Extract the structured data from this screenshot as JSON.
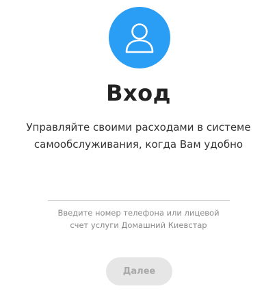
{
  "colors": {
    "accent": "#2a9df4",
    "title": "#222222",
    "hint": "#8a8a8a",
    "button_bg": "#e6e6e6",
    "button_text": "#a9a9a9"
  },
  "avatar": {
    "icon": "user-icon"
  },
  "login": {
    "title": "Вход",
    "subtitle_line1": "Управляйте своими расходами в системе",
    "subtitle_line2": "самообслуживания, когда Вам удобно"
  },
  "phone_field": {
    "value": "",
    "hint_line1": "Введите номер телефона или лицевой",
    "hint_line2": "счет услуги Домашний Киевстар"
  },
  "actions": {
    "next_label": "Далее",
    "next_state": "disabled"
  }
}
